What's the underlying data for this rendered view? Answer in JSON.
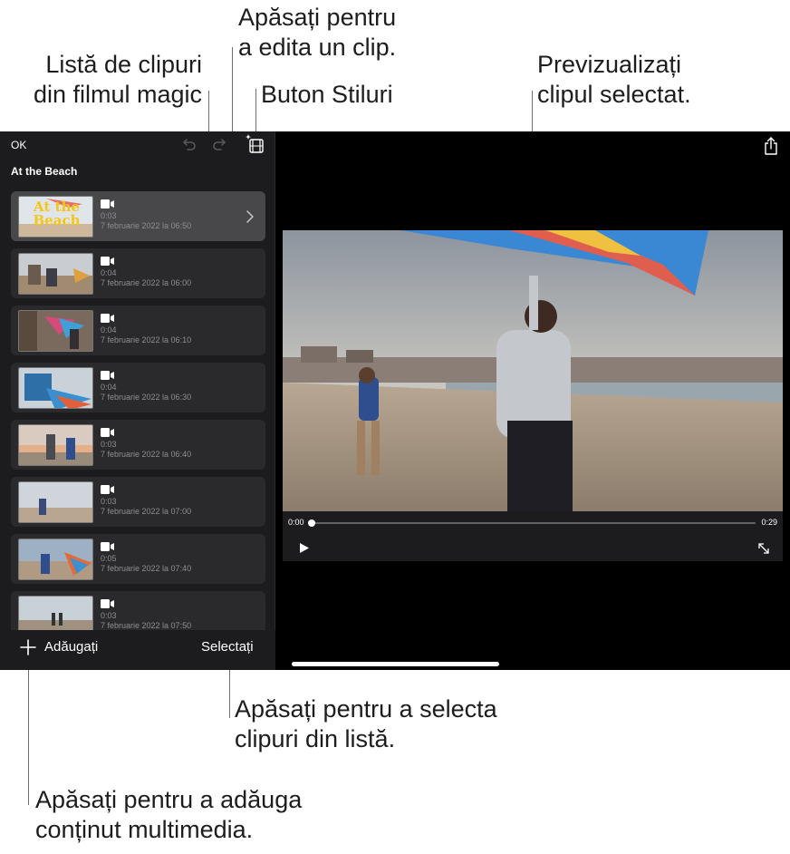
{
  "callouts": {
    "edit_clip": [
      "Apăsați pentru",
      "a edita un clip."
    ],
    "clip_list": [
      "Listă de clipuri",
      "din filmul magic"
    ],
    "styles_button": [
      "Buton Stiluri"
    ],
    "preview": [
      "Previzualizați",
      "clipul selectat."
    ],
    "select_clips": [
      "Apăsați pentru a selecta",
      "clipuri din listă."
    ],
    "add_media": [
      "Apăsați pentru a adăuga",
      "conținut multimedia."
    ]
  },
  "sidebar": {
    "ok_label": "OK",
    "movie_title": "At the Beach",
    "undo_icon": "undo-arrow-icon",
    "redo_icon": "redo-arrow-icon",
    "styles_icon": "film-sparkle-icon"
  },
  "clips": [
    {
      "title_overlay": "At the Beach",
      "duration": "0:03",
      "date": "7 februarie 2022 la 06:50",
      "selected": true
    },
    {
      "duration": "0:04",
      "date": "7 februarie 2022 la 06:00",
      "selected": false
    },
    {
      "duration": "0:04",
      "date": "7 februarie 2022 la 06:10",
      "selected": false
    },
    {
      "duration": "0:04",
      "date": "7 februarie 2022 la 06:30",
      "selected": false
    },
    {
      "duration": "0:03",
      "date": "7 februarie 2022 la 06:40",
      "selected": false
    },
    {
      "duration": "0:03",
      "date": "7 februarie 2022 la 07:00",
      "selected": false
    },
    {
      "duration": "0:05",
      "date": "7 februarie 2022 la 07:40",
      "selected": false
    },
    {
      "duration": "0:03",
      "date": "7 februarie 2022 la 07:50",
      "selected": false
    }
  ],
  "bottom_bar": {
    "add_label": "Adăugați",
    "select_label": "Selectați"
  },
  "player": {
    "current_time": "0:00",
    "total_time": "0:29",
    "progress": 0.0
  },
  "colors": {
    "background": "#000000",
    "sidebar": "#1c1c1e",
    "clip_row": "#2a2a2c",
    "clip_selected": "#48484a",
    "title_overlay": "#f5c518"
  }
}
